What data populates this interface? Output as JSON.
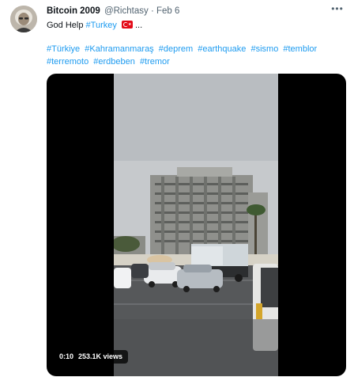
{
  "tweet": {
    "author_name": "Bitcoin 2009",
    "author_handle": "@Richtasy",
    "separator": "·",
    "date": "Feb 6",
    "text_before": "God Help",
    "hashtag_inline": "#Turkey",
    "text_after": "...",
    "more_icon": "more-horizontal-icon",
    "flag_icon": "turkey-flag-emoji",
    "hashtags": [
      "#Türkiye",
      "#Kahramanmaraş",
      "#deprem",
      "#earthquake",
      "#sismo",
      "#temblor",
      "#terremoto",
      "#erdbeben",
      "#tremor"
    ]
  },
  "video": {
    "time": "0:10",
    "views": "253.1K views"
  },
  "colors": {
    "link": "#1d9bf0",
    "text": "#0f1419",
    "muted": "#536471",
    "flag_red": "#e30a17"
  }
}
